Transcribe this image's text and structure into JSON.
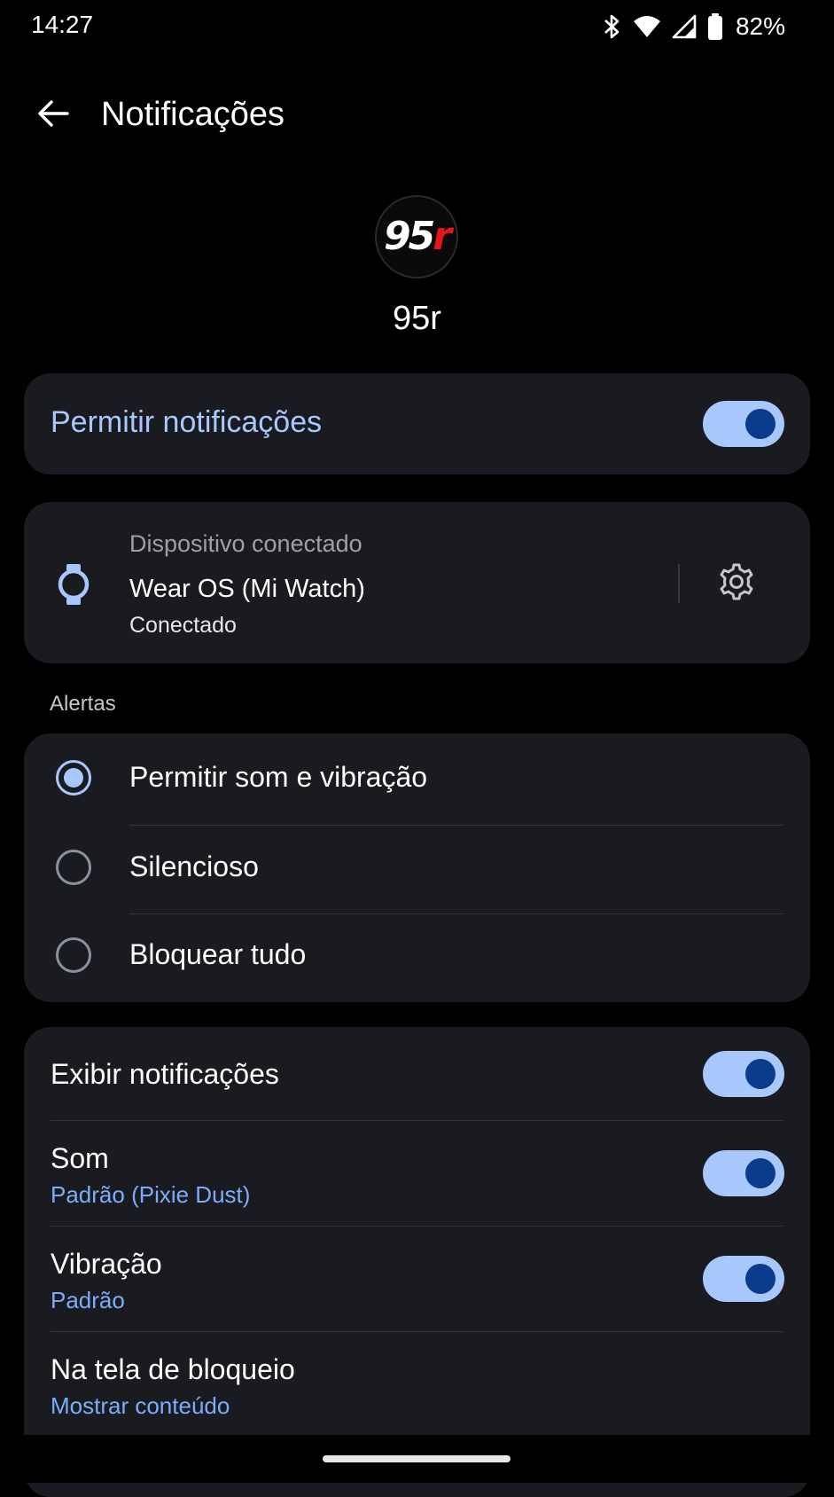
{
  "status_bar": {
    "time": "14:27",
    "battery": "82%",
    "icons": [
      "bluetooth-icon",
      "wifi-icon",
      "cellular-signal-icon",
      "battery-icon"
    ]
  },
  "app_bar": {
    "title": "Notificações",
    "back_icon": "arrow-back-icon"
  },
  "app": {
    "logo_text": "95",
    "logo_accent": "r",
    "name": "95r"
  },
  "allow_notifications": {
    "label": "Permitir notificações",
    "enabled": true
  },
  "connected_device": {
    "caption": "Dispositivo conectado",
    "name": "Wear OS (Mi Watch)",
    "status": "Conectado",
    "icon": "watch-icon",
    "settings_icon": "gear-icon"
  },
  "alerts": {
    "section_label": "Alertas",
    "options": [
      {
        "label": "Permitir som e vibração",
        "selected": true
      },
      {
        "label": "Silencioso",
        "selected": false
      },
      {
        "label": "Bloquear tudo",
        "selected": false
      }
    ]
  },
  "settings": {
    "show_notifications": {
      "title": "Exibir notificações",
      "enabled": true
    },
    "sound": {
      "title": "Som",
      "value": "Padrão (Pixie Dust)",
      "enabled": true
    },
    "vibration": {
      "title": "Vibração",
      "value": "Padrão",
      "enabled": true
    },
    "lock_screen": {
      "title": "Na tela de bloqueio",
      "value": "Mostrar conteúdo"
    }
  },
  "colors": {
    "accent": "#a8c7fa",
    "link": "#7cacf8",
    "card": "#1a1b21",
    "background": "#000000",
    "toggle_knob": "#0b3c8c",
    "logo_red": "#e8141c"
  }
}
